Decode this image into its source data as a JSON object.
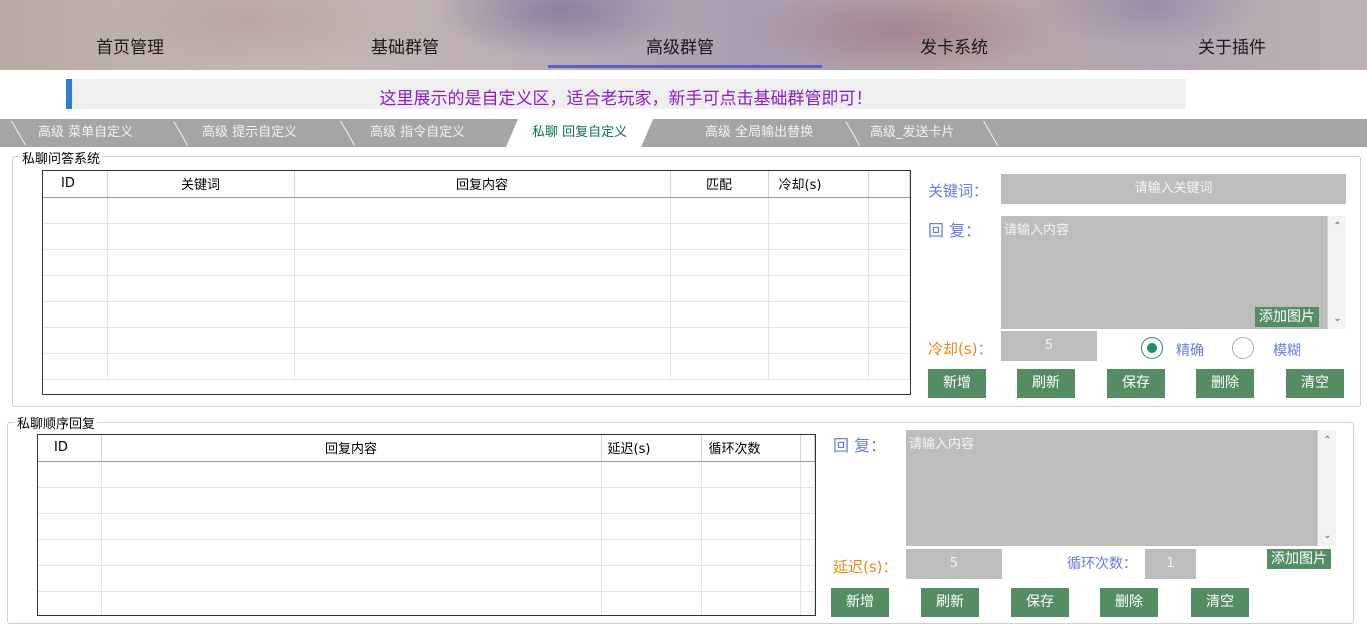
{
  "nav": {
    "items": [
      "首页管理",
      "基础群管",
      "高级群管",
      "发卡系统",
      "关于插件"
    ]
  },
  "notice": "这里展示的是自定义区，适合老玩家，新手可点击基础群管即可！",
  "tabs": [
    "高级 菜单自定义",
    "高级 提示自定义",
    "高级 指令自定义",
    "私聊 回复自定义",
    "高级 全局输出替换",
    "高级_发送卡片"
  ],
  "active_tab": "私聊 回复自定义",
  "qa": {
    "title": "私聊问答系统",
    "columns": [
      "ID",
      "关键词",
      "回复内容",
      "匹配",
      "冷却(s)"
    ],
    "keyword_label": "关键词：",
    "keyword_placeholder": "请输入关键词",
    "reply_label": "回 复：",
    "reply_placeholder": "请输入内容",
    "add_image": "添加图片",
    "cooldown_label": "冷却(s)：",
    "cooldown_value": "5",
    "match_exact": "精确",
    "match_fuzzy": "模糊",
    "match_selected": "精确",
    "buttons": [
      "新增",
      "刷新",
      "保存",
      "删除",
      "清空"
    ]
  },
  "seq": {
    "title": "私聊顺序回复",
    "columns": [
      "ID",
      "回复内容",
      "延迟(s)",
      "循环次数"
    ],
    "reply_label": "回 复：",
    "reply_placeholder": "请输入内容",
    "delay_label": "延迟(s)：",
    "delay_value": "5",
    "loop_label": "循环次数：",
    "loop_value": "1",
    "add_image": "添加图片",
    "buttons": [
      "新增",
      "刷新",
      "保存",
      "删除",
      "清空"
    ]
  },
  "colors": {
    "accent_green": "#548d64",
    "label_blue": "#6b7ae0",
    "label_orange": "#e8861e",
    "notice_purple": "#8a1ec9",
    "field_gray": "#bdbdbd"
  }
}
